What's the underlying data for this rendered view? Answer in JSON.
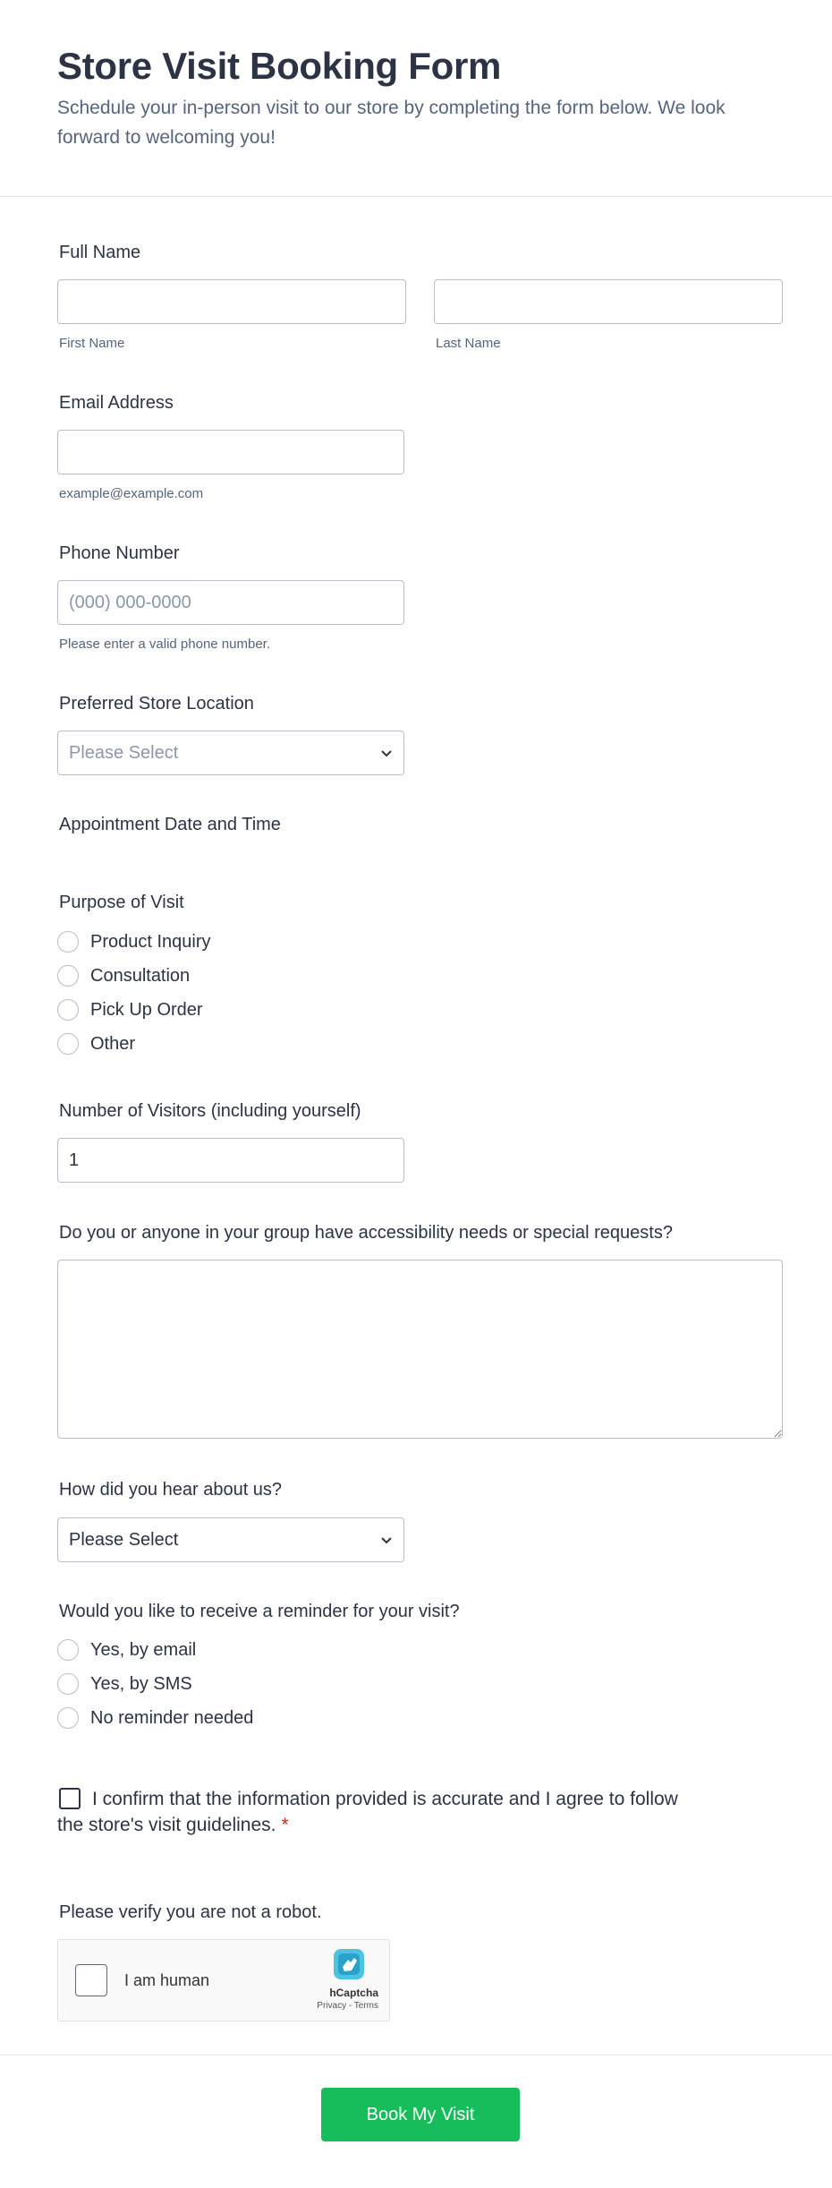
{
  "header": {
    "title": "Store Visit Booking Form",
    "subtitle": "Schedule your in-person visit to our store by completing the form below. We look forward to welcoming you!"
  },
  "full_name": {
    "label": "Full Name",
    "first_value": "",
    "first_sublabel": "First Name",
    "last_value": "",
    "last_sublabel": "Last Name"
  },
  "email": {
    "label": "Email Address",
    "value": "",
    "sublabel": "example@example.com"
  },
  "phone": {
    "label": "Phone Number",
    "placeholder": "(000) 000-0000",
    "sublabel": "Please enter a valid phone number."
  },
  "store_location": {
    "label": "Preferred Store Location",
    "selected": "Please Select"
  },
  "appointment": {
    "label": "Appointment Date and Time"
  },
  "purpose": {
    "label": "Purpose of Visit",
    "options": [
      "Product Inquiry",
      "Consultation",
      "Pick Up Order",
      "Other"
    ]
  },
  "visitors": {
    "label": "Number of Visitors (including yourself)",
    "value": "1"
  },
  "accessibility": {
    "label": "Do you or anyone in your group have accessibility needs or special requests?",
    "value": ""
  },
  "referral": {
    "label": "How did you hear about us?",
    "selected": "Please Select"
  },
  "reminder": {
    "label": "Would you like to receive a reminder for your visit?",
    "options": [
      "Yes, by email",
      "Yes, by SMS",
      "No reminder needed"
    ]
  },
  "consent": {
    "line1": "I confirm that the information provided is accurate and I agree to follow",
    "line2": "the store's visit guidelines.",
    "required_mark": "*"
  },
  "captcha": {
    "label": "Please verify you are not a robot.",
    "checkbox_label": "I am human",
    "brand": "hCaptcha",
    "links": "Privacy - Terms"
  },
  "submit": {
    "label": "Book My Visit"
  },
  "colors": {
    "accent": "#18bd5b",
    "text": "#2c3345",
    "muted": "#57647e",
    "required": "#e21c1c"
  }
}
